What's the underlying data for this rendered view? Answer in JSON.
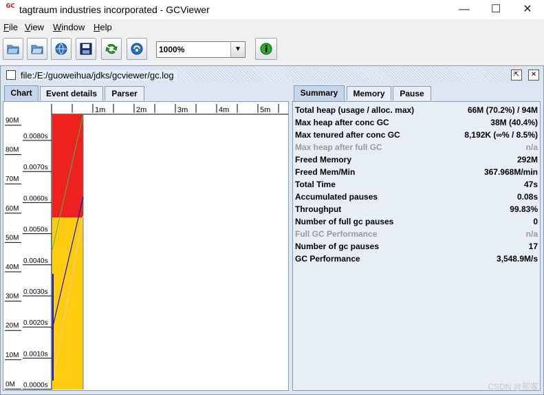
{
  "window": {
    "title": "tagtraum industries incorporated - GCViewer",
    "icon_text": "GC",
    "minimize_glyph": "—",
    "maximize_glyph": "☐",
    "close_glyph": "✕"
  },
  "menubar": {
    "items": [
      {
        "label": "File"
      },
      {
        "label": "View"
      },
      {
        "label": "Window"
      },
      {
        "label": "Help"
      }
    ]
  },
  "toolbar": {
    "buttons": [
      {
        "icon": "open-file-icon"
      },
      {
        "icon": "open-folder-icon"
      },
      {
        "icon": "open-url-icon"
      },
      {
        "icon": "save-icon"
      },
      {
        "icon": "refresh-icon"
      },
      {
        "icon": "watch-icon"
      }
    ],
    "zoom_value": "1000%",
    "info_icon": "info-icon"
  },
  "frame": {
    "title": "file:/E:/guoweihua/jdks/gcviewer/gc.log"
  },
  "left_tabs": [
    {
      "label": "Chart"
    },
    {
      "label": "Event details"
    },
    {
      "label": "Parser"
    }
  ],
  "right_tabs": [
    {
      "label": "Summary"
    },
    {
      "label": "Memory"
    },
    {
      "label": "Pause"
    }
  ],
  "chart": {
    "time_ticks": [
      "1m",
      "2m",
      "3m",
      "4m",
      "5m"
    ],
    "memory_ticks": [
      "90M",
      "80M",
      "70M",
      "60M",
      "50M",
      "40M",
      "30M",
      "20M",
      "10M",
      "0M"
    ],
    "pause_ticks": [
      "0.0080s",
      "0.0070s",
      "0.0060s",
      "0.0050s",
      "0.0040s",
      "0.0030s",
      "0.0020s",
      "0.0010s",
      "0.0000s"
    ],
    "colors": {
      "tenured": "#ee2020",
      "young": "#ffcc10",
      "used_line": "#1010c0",
      "green_line": "#40c040"
    }
  },
  "summary": {
    "rows": [
      {
        "label": "Total heap (usage / alloc. max)",
        "value": "66M (70.2%) / 94M",
        "enabled": true
      },
      {
        "label": "Max heap after conc GC",
        "value": "38M (40.4%)",
        "enabled": true
      },
      {
        "label": "Max tenured after conc GC",
        "value": "8,192K (∞% / 8.5%)",
        "enabled": true
      },
      {
        "label": "Max heap after full GC",
        "value": "n/a",
        "enabled": false
      },
      {
        "label": "Freed Memory",
        "value": "292M",
        "enabled": true
      },
      {
        "label": "Freed Mem/Min",
        "value": "367.968M/min",
        "enabled": true
      },
      {
        "label": "Total Time",
        "value": "47s",
        "enabled": true
      },
      {
        "label": "Accumulated pauses",
        "value": "0.08s",
        "enabled": true
      },
      {
        "label": "Throughput",
        "value": "99.83%",
        "enabled": true
      },
      {
        "label": "Number of full gc pauses",
        "value": "0",
        "enabled": true
      },
      {
        "label": "Full GC Performance",
        "value": "n/a",
        "enabled": false
      },
      {
        "label": "Number of gc pauses",
        "value": "17",
        "enabled": true
      },
      {
        "label": "GC Performance",
        "value": "3,548.9M/s",
        "enabled": true
      }
    ]
  },
  "watermark": "CSDN @熙客"
}
